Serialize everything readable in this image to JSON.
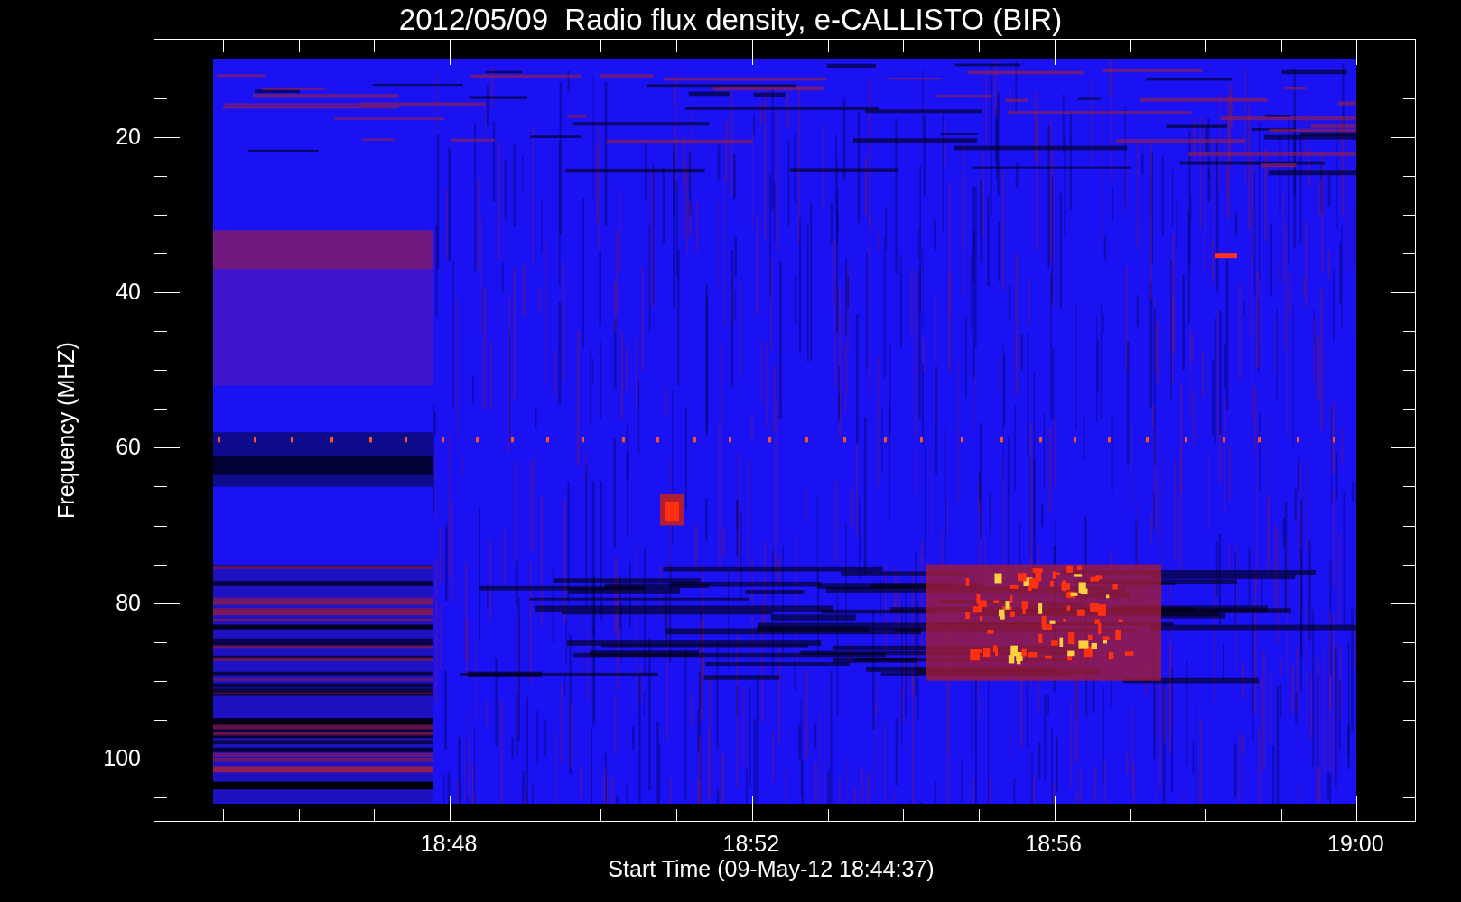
{
  "title": "2012/05/09  Radio flux density, e-CALLISTO (BIR)",
  "ylabel": "Frequency (MHZ)",
  "xlabel": "Start Time (09-May-12 18:44:37)",
  "yticks": [
    "20",
    "40",
    "60",
    "80",
    "100"
  ],
  "xticks": [
    "18:48",
    "18:52",
    "18:56",
    "19:00"
  ]
}
